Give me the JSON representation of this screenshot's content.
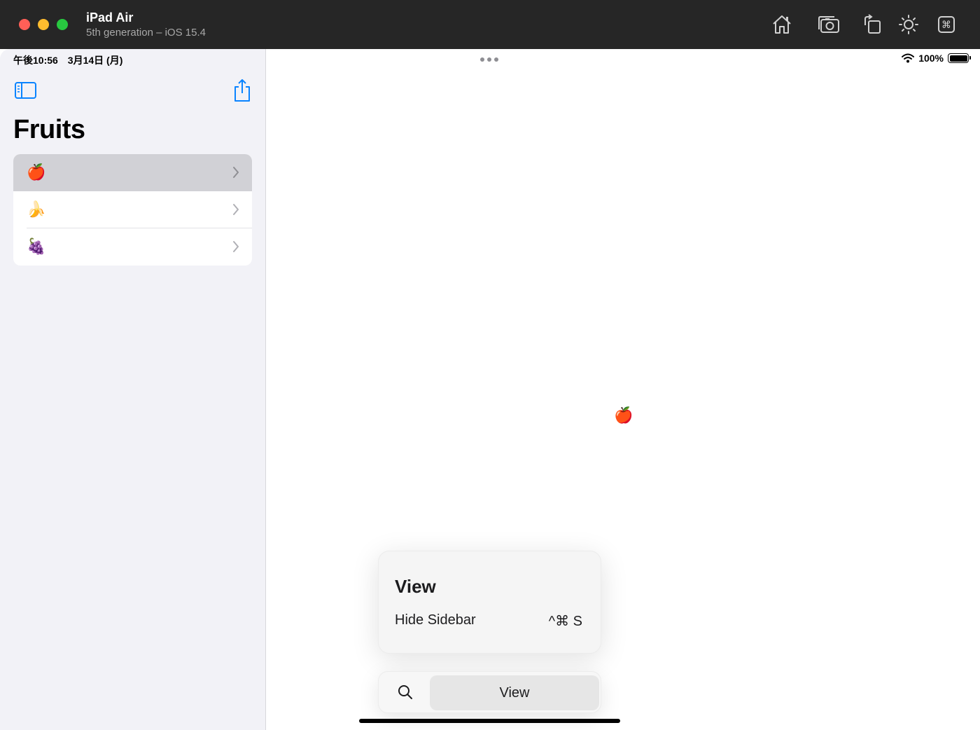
{
  "window": {
    "title": "iPad Air",
    "subtitle": "5th generation – iOS 15.4",
    "toolbar_icons": [
      "home-icon",
      "screenshot-icon",
      "rotate-icon",
      "appearance-icon",
      "keyboard-command-icon"
    ]
  },
  "status_bar": {
    "time_date": "午後10:56　3月14日 (月)",
    "battery_level": "100%"
  },
  "sidebar": {
    "title": "Fruits",
    "items": [
      {
        "emoji": "🍎",
        "selected": true
      },
      {
        "emoji": "🍌",
        "selected": false
      },
      {
        "emoji": "🍇",
        "selected": false
      }
    ]
  },
  "detail": {
    "emoji": "🍎"
  },
  "shortcut_menu": {
    "title": "View",
    "items": [
      {
        "label": "Hide Sidebar",
        "shortcut": "^⌘ S"
      }
    ]
  },
  "hud_bar": {
    "tab_label": "View"
  },
  "colors": {
    "accent": "#0a84ff",
    "sidebar_bg": "#f2f2f7",
    "selected_row": "#d1d1d6"
  }
}
